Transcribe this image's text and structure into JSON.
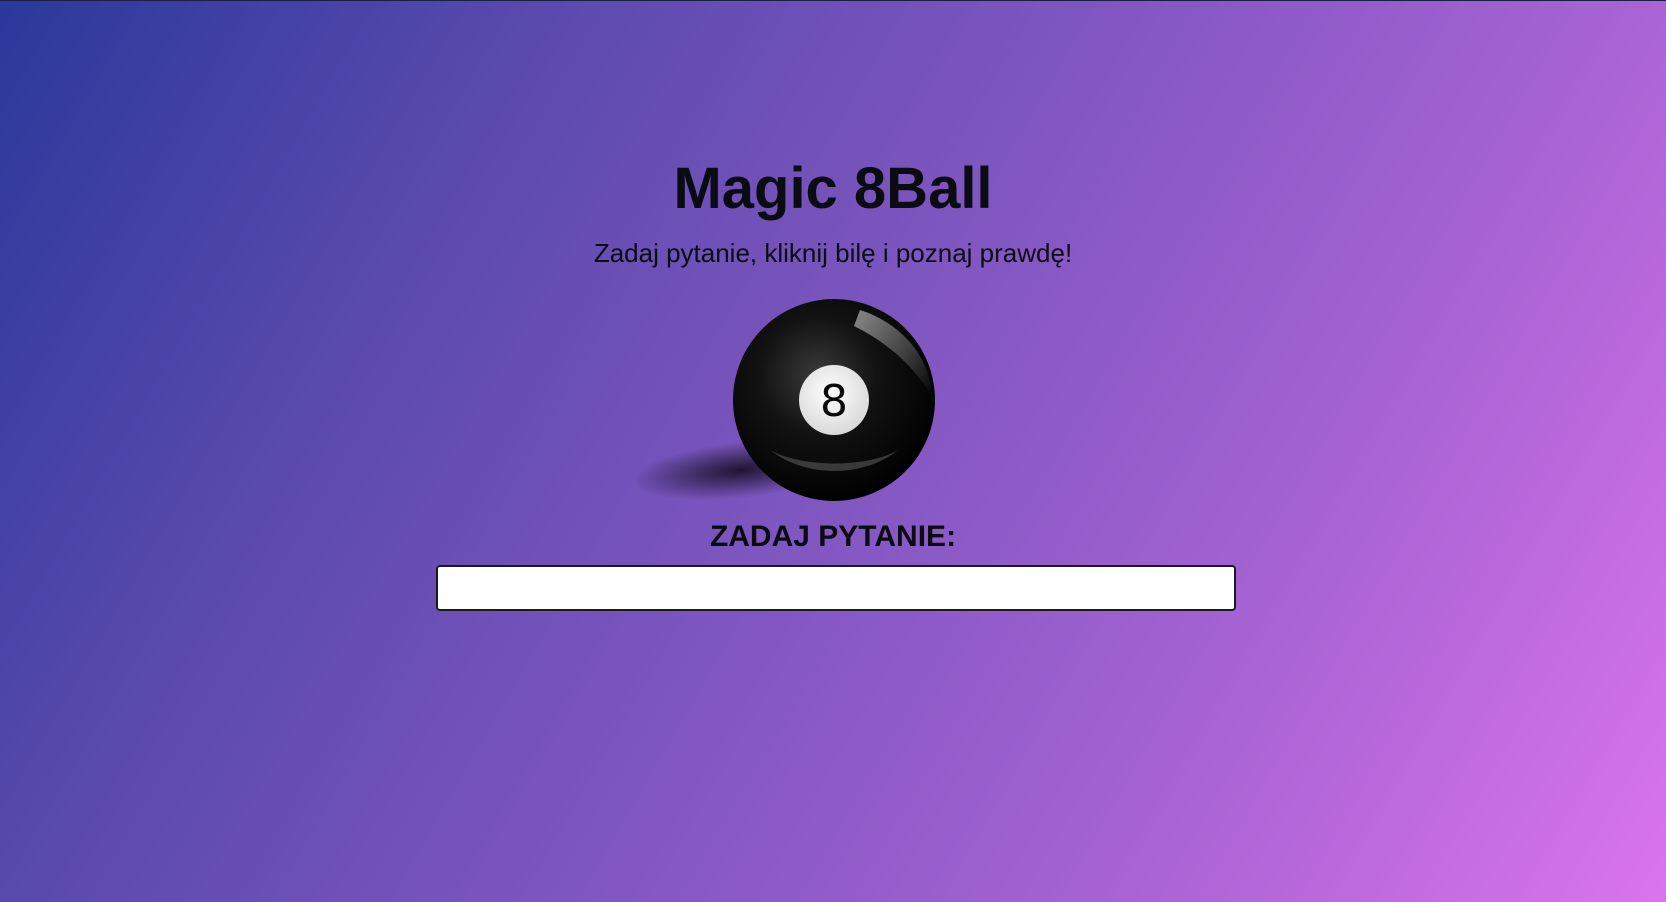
{
  "page": {
    "title": "Magic 8Ball",
    "subtitle": "Zadaj pytanie, kliknij bilę i poznaj prawdę!"
  },
  "ball": {
    "number": "8",
    "icon": "magic-8-ball-icon"
  },
  "question": {
    "label": "ZADAJ PYTANIE:",
    "value": "",
    "placeholder": ""
  },
  "colors": {
    "gradient_start": "#2b389b",
    "gradient_end": "#da74ec",
    "ball": "#0a0a0a",
    "text": "#0b0b12"
  }
}
